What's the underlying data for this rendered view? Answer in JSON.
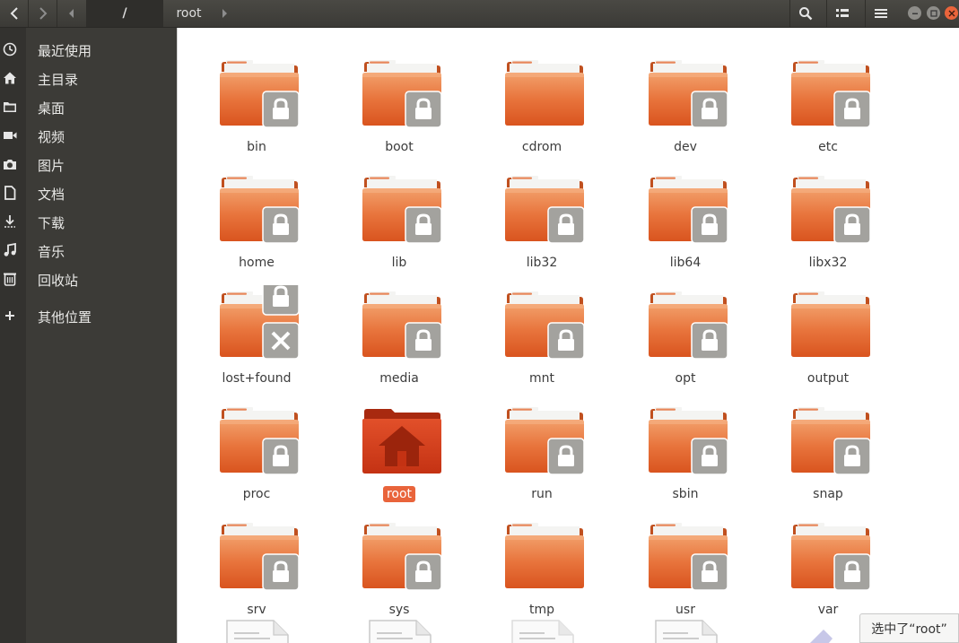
{
  "header": {
    "back_icon": "chevron-left-icon",
    "forward_icon": "chevron-right-icon",
    "path": [
      "/",
      "root"
    ],
    "search_icon": "search-icon",
    "view_icon": "view-list-icon",
    "menu_icon": "hamburger-menu-icon"
  },
  "sidebar": {
    "items": [
      {
        "label": "最近使用",
        "icon": "clock-icon"
      },
      {
        "label": "主目录",
        "icon": "home-icon"
      },
      {
        "label": "桌面",
        "icon": "folder-icon"
      },
      {
        "label": "视频",
        "icon": "video-icon"
      },
      {
        "label": "图片",
        "icon": "camera-icon"
      },
      {
        "label": "文档",
        "icon": "document-icon"
      },
      {
        "label": "下载",
        "icon": "download-icon"
      },
      {
        "label": "音乐",
        "icon": "music-icon"
      },
      {
        "label": "回收站",
        "icon": "trash-icon"
      },
      {
        "label": "其他位置",
        "icon": "plus-icon"
      }
    ]
  },
  "files": [
    {
      "name": "bin",
      "locked": true
    },
    {
      "name": "boot",
      "locked": true
    },
    {
      "name": "cdrom",
      "locked": false
    },
    {
      "name": "dev",
      "locked": true
    },
    {
      "name": "etc",
      "locked": true
    },
    {
      "name": "home",
      "locked": true
    },
    {
      "name": "lib",
      "locked": true
    },
    {
      "name": "lib32",
      "locked": true
    },
    {
      "name": "lib64",
      "locked": true
    },
    {
      "name": "libx32",
      "locked": true
    },
    {
      "name": "lost+found",
      "locked": true,
      "unreadable": true
    },
    {
      "name": "media",
      "locked": true
    },
    {
      "name": "mnt",
      "locked": true
    },
    {
      "name": "opt",
      "locked": true
    },
    {
      "name": "output",
      "locked": false
    },
    {
      "name": "proc",
      "locked": true
    },
    {
      "name": "root",
      "home": true,
      "selected": true
    },
    {
      "name": "run",
      "locked": true
    },
    {
      "name": "sbin",
      "locked": true
    },
    {
      "name": "snap",
      "locked": true
    },
    {
      "name": "srv",
      "locked": true
    },
    {
      "name": "sys",
      "locked": true
    },
    {
      "name": "tmp",
      "locked": false
    },
    {
      "name": "usr",
      "locked": true
    },
    {
      "name": "var",
      "locked": true
    }
  ],
  "status": {
    "tooltip": "选中了“root”"
  },
  "colors": {
    "accent": "#e9643b",
    "folder_orange": "#e8743c",
    "selected_folder": "#cf3d16",
    "sidebar_bg": "#3c3b37"
  }
}
